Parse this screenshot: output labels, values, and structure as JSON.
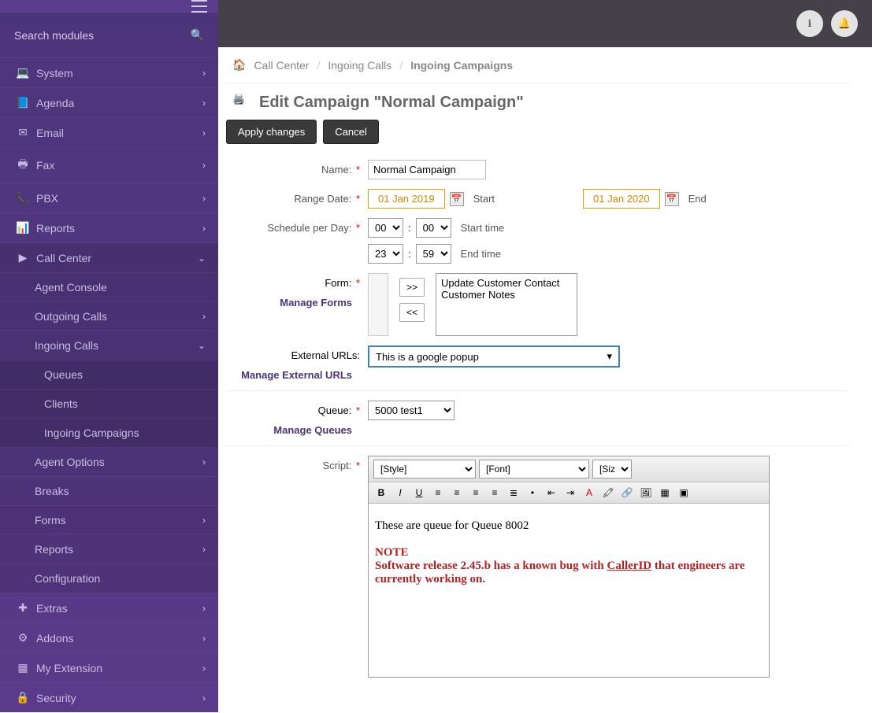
{
  "sidebar": {
    "search_placeholder": "Search modules",
    "items": [
      {
        "label": "System",
        "icon": "laptop"
      },
      {
        "label": "Agenda",
        "icon": "book"
      },
      {
        "label": "Email",
        "icon": "envelope"
      },
      {
        "label": "Fax",
        "icon": "print"
      },
      {
        "label": "PBX",
        "icon": "phone"
      },
      {
        "label": "Reports",
        "icon": "chart"
      },
      {
        "label": "Call Center",
        "icon": "play",
        "expanded": true
      },
      {
        "label": "Extras",
        "icon": "plus"
      },
      {
        "label": "Addons",
        "icon": "gears"
      },
      {
        "label": "My Extension",
        "icon": "grid"
      },
      {
        "label": "Security",
        "icon": "lock"
      }
    ],
    "call_center_sub": [
      {
        "label": "Agent Console"
      },
      {
        "label": "Outgoing Calls",
        "chev": true
      },
      {
        "label": "Ingoing Calls",
        "chev": true,
        "expanded": true
      },
      {
        "label": "Agent Options",
        "chev": true
      },
      {
        "label": "Breaks"
      },
      {
        "label": "Forms",
        "chev": true
      },
      {
        "label": "Reports",
        "chev": true
      },
      {
        "label": "Configuration"
      }
    ],
    "ingoing_sub": [
      "Queues",
      "Clients",
      "Ingoing Campaigns"
    ]
  },
  "breadcrumb": {
    "a": "Call Center",
    "b": "Ingoing Calls",
    "c": "Ingoing Campaigns"
  },
  "page_title": "Edit Campaign \"Normal Campaign\"",
  "buttons": {
    "apply": "Apply changes",
    "cancel": "Cancel"
  },
  "form": {
    "name_label": "Name:",
    "name_value": "Normal Campaign",
    "range_label": "Range Date:",
    "range_start": "01 Jan 2019",
    "range_end": "01 Jan 2020",
    "start_text": "Start",
    "end_text": "End",
    "schedule_label": "Schedule per Day:",
    "sh_start_h": "00",
    "sh_start_m": "00",
    "sh_end_h": "23",
    "sh_end_m": "59",
    "start_time_text": "Start time",
    "end_time_text": "End time",
    "form_label": "Form:",
    "manage_forms": "Manage Forms",
    "form_list_1": "Update Customer Contact",
    "form_list_2": "Customer Notes",
    "ext_url_label": "External URLs:",
    "ext_url_value": "This is a google popup",
    "manage_ext_urls": "Manage External URLs",
    "queue_label": "Queue:",
    "queue_value": "5000 test1",
    "manage_queues": "Manage Queues",
    "script_label": "Script:",
    "editor": {
      "style": "[Style]",
      "font": "[Font]",
      "size": "[Size]",
      "line1": "These are queue for Queue 8002",
      "note_heading": "NOTE",
      "note_body_a": "Software release 2.45.b has a known bug with ",
      "note_body_link": "CallerID",
      "note_body_b": " that engineers are currently working on."
    }
  }
}
